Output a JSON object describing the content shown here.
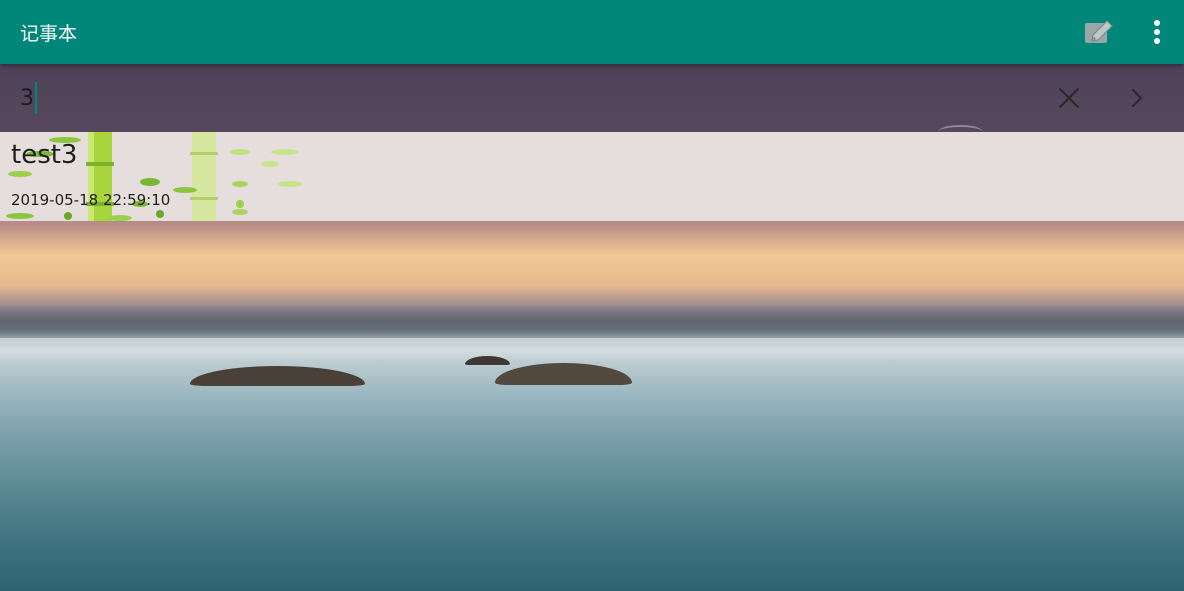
{
  "appbar": {
    "title": "记事本",
    "background": "#00877a",
    "icons": [
      "edit-note-icon",
      "more-vert-icon"
    ]
  },
  "search": {
    "query": "3",
    "icons": [
      "close-icon",
      "chevron-right-icon"
    ]
  },
  "notes": [
    {
      "title": "test3",
      "date": "2019-05-18 22:59:10"
    }
  ]
}
